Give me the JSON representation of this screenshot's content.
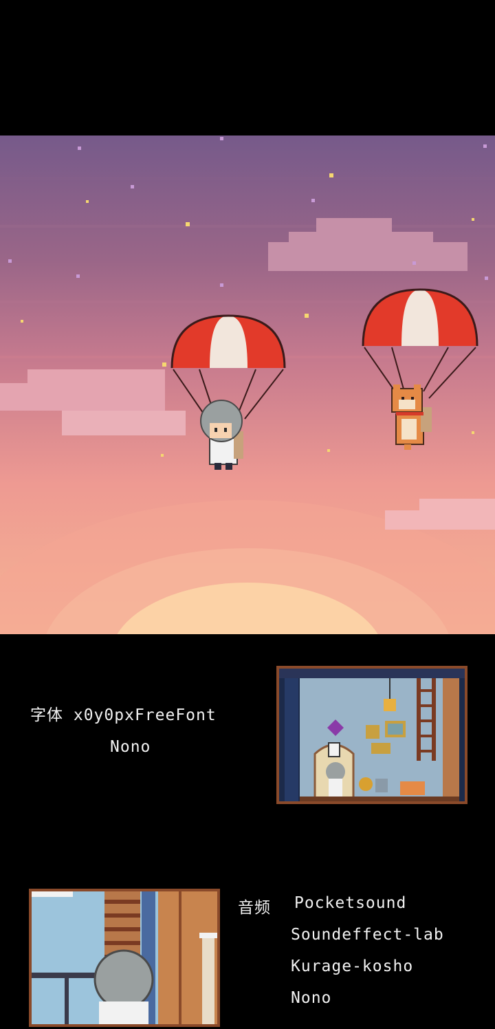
{
  "credits": {
    "font_label": "字体",
    "font_name": "x0y0pxFreeFont",
    "font_author": "Nono",
    "audio_label": "音频",
    "audio_credits": [
      "Pocketsound",
      "Soundeffect-lab",
      "Kurage-kosho",
      "Nono"
    ]
  },
  "colors": {
    "sky_top": "#7a5c8c",
    "sky_mid": "#c0708a",
    "sky_low": "#f0a890",
    "sun": "#fcd6a8",
    "chute_red": "#e23a2a",
    "chute_white": "#f2e6dc",
    "frame_border": "#8a4a2a"
  }
}
